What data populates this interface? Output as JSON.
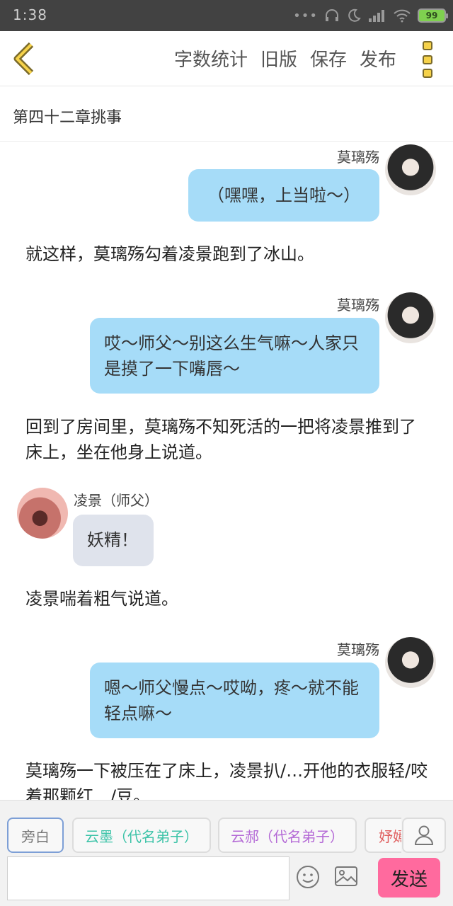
{
  "status_bar": {
    "time": "1:38",
    "battery": "99"
  },
  "toolbar": {
    "word_count": "字数统计",
    "old_version": "旧版",
    "save": "保存",
    "publish": "发布"
  },
  "chapter_title": "第四十二章挑事",
  "messages": [
    {
      "type": "dialog",
      "side": "right",
      "speaker": "莫璃殇",
      "text": "（嘿嘿，上当啦～）"
    },
    {
      "type": "narration",
      "text": "就这样，莫璃殇勾着凌景跑到了冰山。"
    },
    {
      "type": "dialog",
      "side": "right",
      "speaker": "莫璃殇",
      "text": "哎～师父～别这么生气嘛～人家只是摸了一下嘴唇～"
    },
    {
      "type": "narration",
      "text": "回到了房间里，莫璃殇不知死活的一把将凌景推到了床上，坐在他身上说道。"
    },
    {
      "type": "dialog",
      "side": "left",
      "speaker": "凌景（师父）",
      "text": "妖精！"
    },
    {
      "type": "narration",
      "text": "凌景喘着粗气说道。"
    },
    {
      "type": "dialog",
      "side": "right",
      "speaker": "莫璃殇",
      "text": "嗯～师父慢点～哎呦，疼～就不能轻点嘛～"
    },
    {
      "type": "narration",
      "text": "莫璃殇一下被压在了床上，凌景扒/…开他的衣服轻/咬着那颗红　/豆。"
    }
  ],
  "speakers": [
    {
      "label": "旁白",
      "color": "#777777"
    },
    {
      "label": "云墨（代名弟子）",
      "color": "#3cc3a8"
    },
    {
      "label": "云郝（代名弟子）",
      "color": "#b46ad6"
    },
    {
      "label": "妤嫣",
      "color": "#e06060"
    }
  ],
  "composer": {
    "value": "",
    "placeholder": "",
    "send_label": "发送"
  }
}
